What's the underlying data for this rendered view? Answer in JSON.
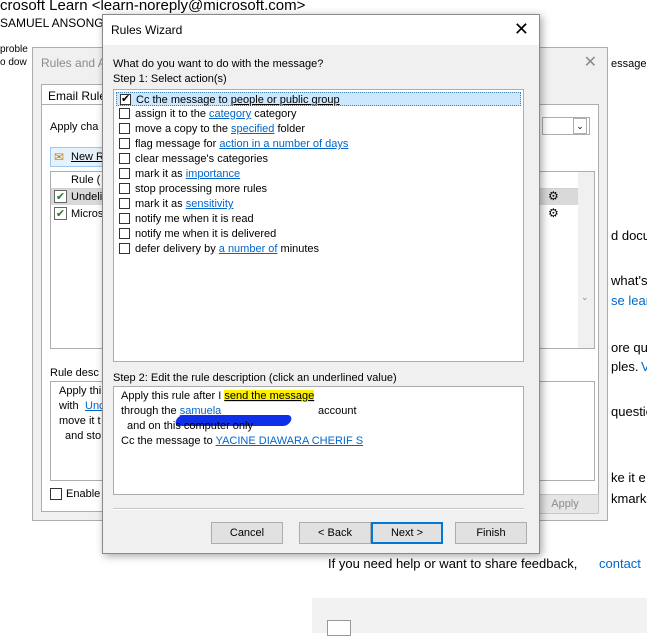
{
  "email_header": {
    "from": "crosoft Learn <learn-noreply@microsoft.com>",
    "to": "SAMUEL ANSONG"
  },
  "background_page": {
    "left_fragments": [
      "proble",
      "o dow"
    ],
    "right_fragments": [
      "essage.",
      "d docu",
      "what's",
      "se lear",
      "ore qu",
      "ples.",
      "V",
      "questio",
      "ke it e",
      "kmarks"
    ],
    "feedback_text": "If you need help or want to share feedback,",
    "feedback_link": "contact"
  },
  "rules_alerts": {
    "title": "Rules and A",
    "tab": "Email Rule",
    "apply_label": "Apply cha",
    "new_rule": "New R",
    "col_rule": "Rule (",
    "rows": [
      "Undeli",
      "Micros"
    ],
    "rule_desc_label": "Rule desc",
    "desc_lines": [
      "Apply thi",
      "with",
      "Unc",
      "move it t",
      "and sto"
    ],
    "enable_label": "Enable",
    "apply_button": "Apply"
  },
  "wizard": {
    "title": "Rules Wizard",
    "question": "What do you want to do with the message?",
    "step1": "Step 1: Select action(s)",
    "actions": [
      {
        "checked": true,
        "pre": "Cc the message to ",
        "link": "people or public group",
        "post": ""
      },
      {
        "checked": false,
        "pre": "assign it to the ",
        "link": "category",
        "post": " category"
      },
      {
        "checked": false,
        "pre": "move a copy to the ",
        "link": "specified",
        "post": " folder"
      },
      {
        "checked": false,
        "pre": "flag message for ",
        "link": "action in a number of days",
        "post": ""
      },
      {
        "checked": false,
        "pre": "clear message's categories",
        "link": "",
        "post": ""
      },
      {
        "checked": false,
        "pre": "mark it as ",
        "link": "importance",
        "post": ""
      },
      {
        "checked": false,
        "pre": "stop processing more rules",
        "link": "",
        "post": ""
      },
      {
        "checked": false,
        "pre": "mark it as ",
        "link": "sensitivity",
        "post": ""
      },
      {
        "checked": false,
        "pre": "notify me when it is read",
        "link": "",
        "post": ""
      },
      {
        "checked": false,
        "pre": "notify me when it is delivered",
        "link": "",
        "post": ""
      },
      {
        "checked": false,
        "pre": "defer delivery by ",
        "link": "a number of",
        "post": " minutes"
      }
    ],
    "step2": "Step 2: Edit the rule description (click an underlined value)",
    "description": {
      "line1_pre": "Apply this rule after I ",
      "line1_link": "send the message",
      "line2_pre": "through the ",
      "line2_link": "samuela",
      "line2_post": "account",
      "line3": "and on this computer only",
      "line4_pre": "Cc the message to ",
      "line4_link": "YACINE DIAWARA CHERIF S"
    },
    "buttons": {
      "cancel": "Cancel",
      "back": "< Back",
      "next": "Next >",
      "finish": "Finish"
    }
  },
  "colors": {
    "link": "#0066cc",
    "selection": "#cce8ff",
    "highlight": "#fff200",
    "default_button_border": "#0078d7"
  }
}
